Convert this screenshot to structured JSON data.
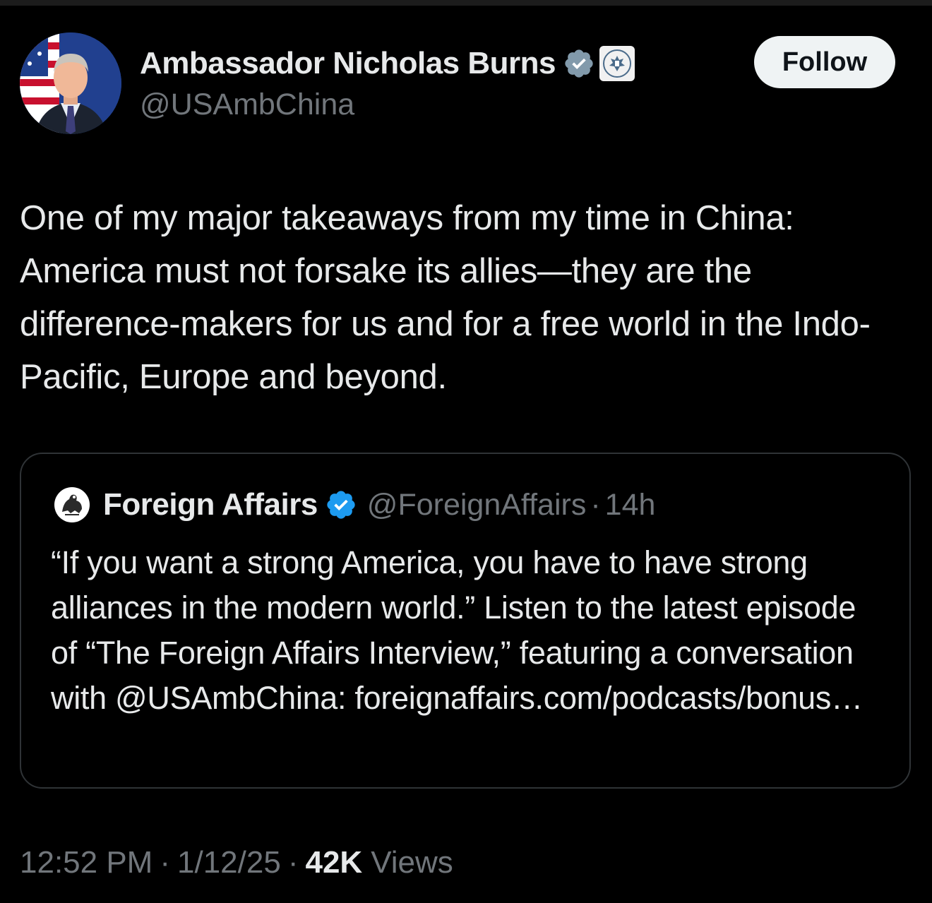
{
  "author": {
    "display_name": "Ambassador Nicholas Burns",
    "handle": "@USAmbChina",
    "verified_badge_color": "#829aab",
    "affiliation_icon": "us-state-dept-seal-icon"
  },
  "follow_button": {
    "label": "Follow"
  },
  "tweet": {
    "text": "One of my major takeaways from my time in China: America must not forsake its allies—they are the difference-makers for us and for a free world in the Indo-Pacific, Europe and beyond."
  },
  "quoted_tweet": {
    "display_name": "Foreign Affairs",
    "handle": "@ForeignAffairs",
    "separator": "·",
    "time": "14h",
    "verified_badge_color": "#1d9bf0",
    "text": "“If you want a strong America, you have to have strong alliances in the modern world.” Listen to the latest episode of “The Foreign Affairs Interview,” featuring a conversation with @USAmbChina: foreignaffairs.com/podcasts/bonus…"
  },
  "meta": {
    "time": "12:52 PM",
    "separator": "·",
    "date": "1/12/25",
    "views_count": "42K",
    "views_label": "Views"
  },
  "colors": {
    "background": "#000000",
    "primary_text": "#e7e9ea",
    "secondary_text": "#71767b",
    "border": "#2f3336",
    "button_bg": "#eff3f4"
  }
}
